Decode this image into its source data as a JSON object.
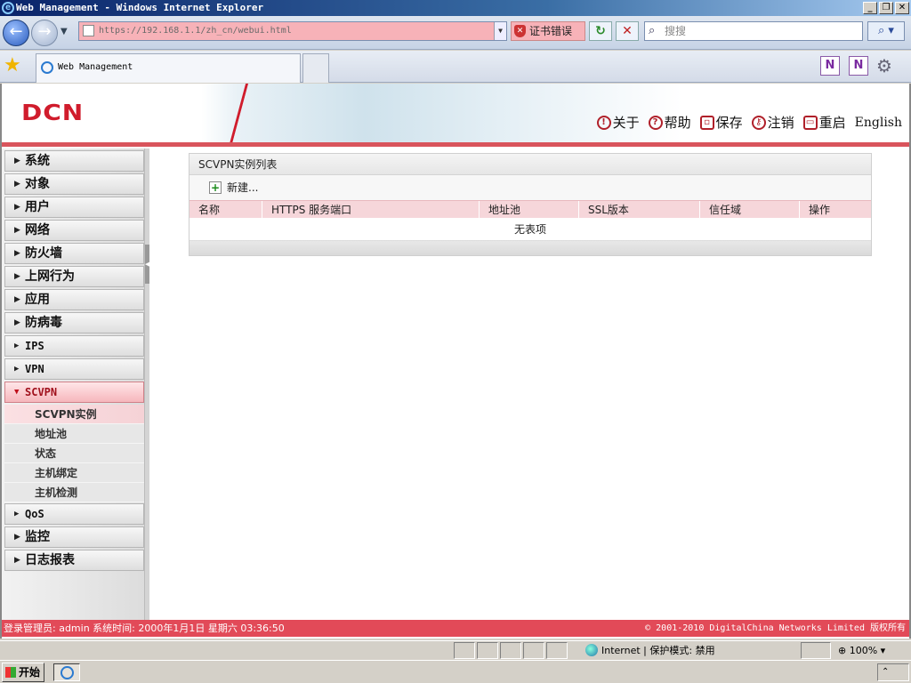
{
  "browser": {
    "title": "Web Management - Windows Internet Explorer",
    "address": "https://192.168.1.1/zh_cn/webui.html",
    "cert_error": "证书错误",
    "search_placeholder": "搜搜",
    "tab_title": "Web Management",
    "status_zone": "Internet | 保护模式: 禁用",
    "zoom": "100%"
  },
  "banner": {
    "logo": "DCN",
    "links": [
      {
        "label": "关于",
        "icon": "info-icon"
      },
      {
        "label": "帮助",
        "icon": "help-icon"
      },
      {
        "label": "保存",
        "icon": "save-icon"
      },
      {
        "label": "注销",
        "icon": "key-icon"
      },
      {
        "label": "重启",
        "icon": "restart-icon"
      },
      {
        "label": "English"
      }
    ]
  },
  "sidebar": {
    "items": [
      {
        "label": "系统"
      },
      {
        "label": "对象"
      },
      {
        "label": "用户"
      },
      {
        "label": "网络"
      },
      {
        "label": "防火墙"
      },
      {
        "label": "上网行为"
      },
      {
        "label": "应用"
      },
      {
        "label": "防病毒"
      },
      {
        "label": "IPS"
      },
      {
        "label": "VPN"
      },
      {
        "label": "SCVPN",
        "expanded": true
      },
      {
        "label": "QoS"
      },
      {
        "label": "监控"
      },
      {
        "label": "日志报表"
      }
    ],
    "sub_items": [
      "SCVPN实例",
      "地址池",
      "状态",
      "主机绑定",
      "主机检测"
    ],
    "selected_sub": "SCVPN实例"
  },
  "content": {
    "panel_title": "SCVPN实例列表",
    "new_label": "新建...",
    "columns": [
      "名称",
      "HTTPS 服务端口",
      "地址池",
      "SSL版本",
      "信任域",
      "操作"
    ],
    "empty_text": "无表项"
  },
  "footer": {
    "login_info": "登录管理员: admin 系统时间: 2000年1月1日 星期六 03:36:50",
    "copyright": "© 2001-2010 DigitalChina Networks Limited 版权所有"
  },
  "taskbar": {
    "start_label": "开始"
  },
  "colors": {
    "brand_red": "#d01c2c",
    "active_menu": "#f6b6bc",
    "footer_bg": "#e24a58"
  }
}
